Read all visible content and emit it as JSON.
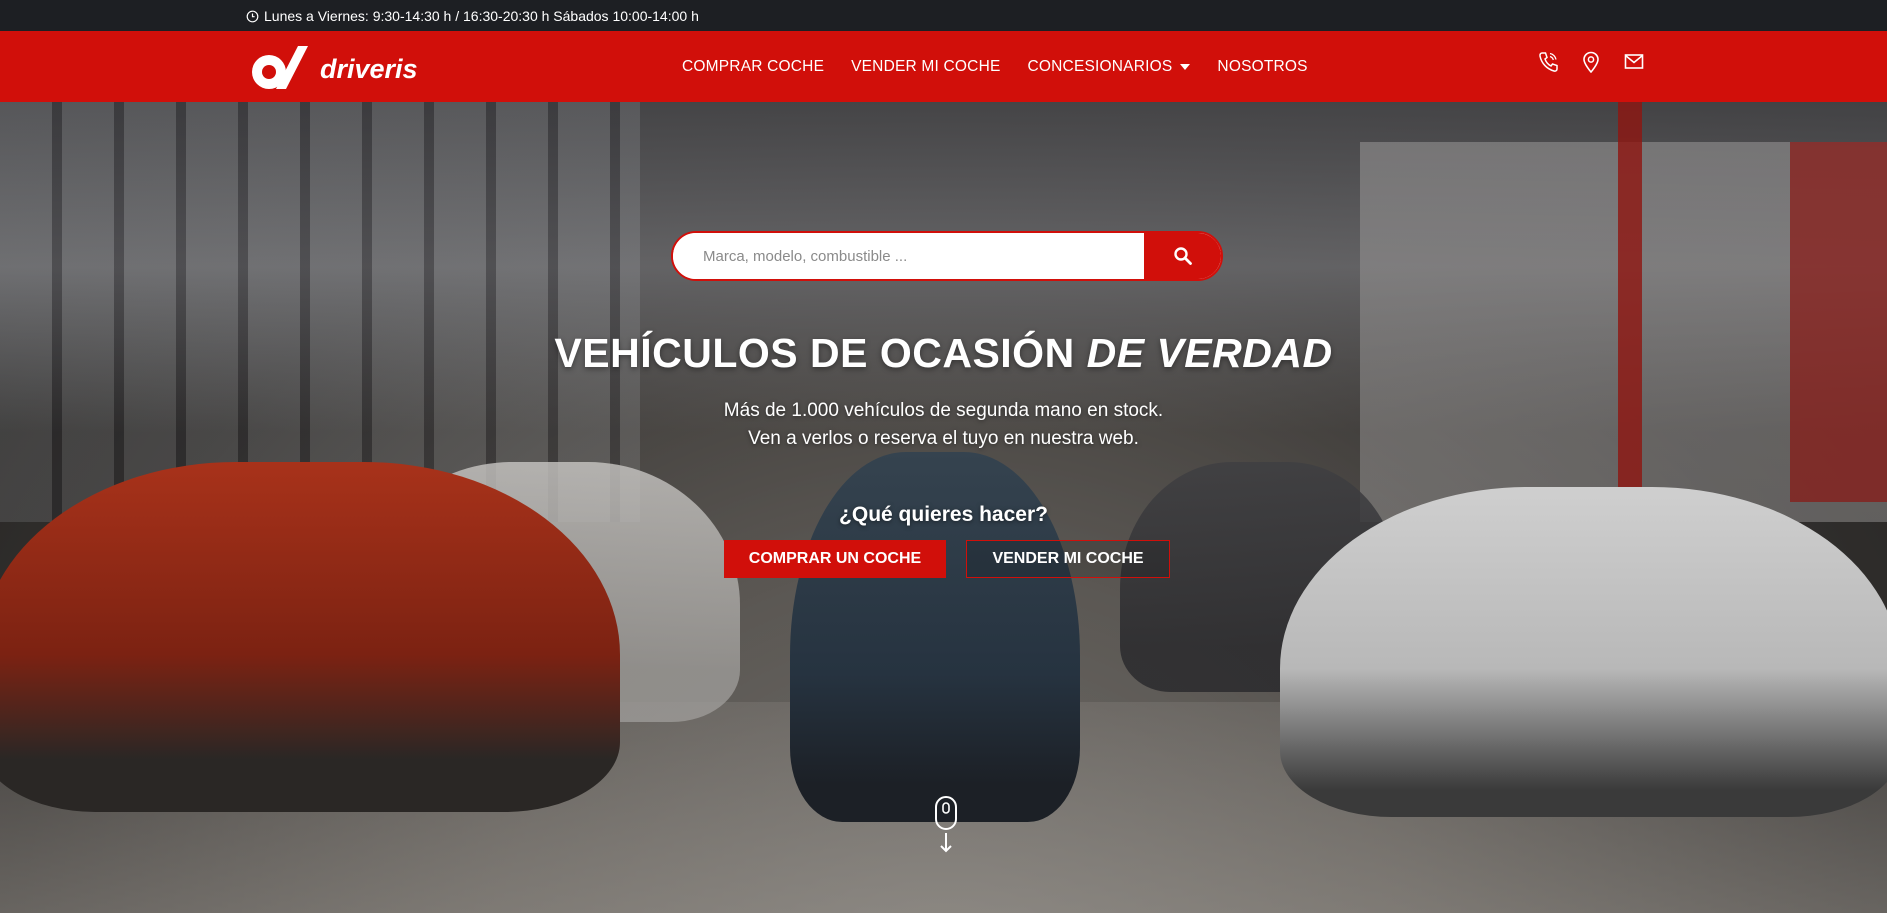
{
  "topbar": {
    "hours": "Lunes a Viernes: 9:30-14:30 h / 16:30-20:30 h Sábados 10:00-14:00 h",
    "icon": "clock-icon"
  },
  "header": {
    "logo_text": "driveris",
    "nav": [
      {
        "label": "COMPRAR COCHE"
      },
      {
        "label": "VENDER MI COCHE"
      },
      {
        "label": "CONCESIONARIOS"
      },
      {
        "label": "NOSOTROS"
      }
    ],
    "icons": [
      "phone-icon",
      "location-pin-icon",
      "mail-icon"
    ]
  },
  "search": {
    "placeholder": "Marca, modelo, combustible ...",
    "value": "",
    "button_icon": "search-icon"
  },
  "hero": {
    "headline_main": "VEHÍCULOS DE OCASIÓN",
    "headline_em": "DE VERDAD",
    "sub_line1": "Más de 1.000 vehículos de segunda mano en stock.",
    "sub_line2": "Ven a verlos o reserva el tuyo en nuestra web.",
    "question": "¿Qué quieres hacer?",
    "cta_buy": "COMPRAR UN COCHE",
    "cta_sell": "VENDER MI COCHE"
  },
  "colors": {
    "brand_red": "#d10f0a",
    "topbar_bg": "#1d1f23",
    "text_light": "#ffffff"
  }
}
